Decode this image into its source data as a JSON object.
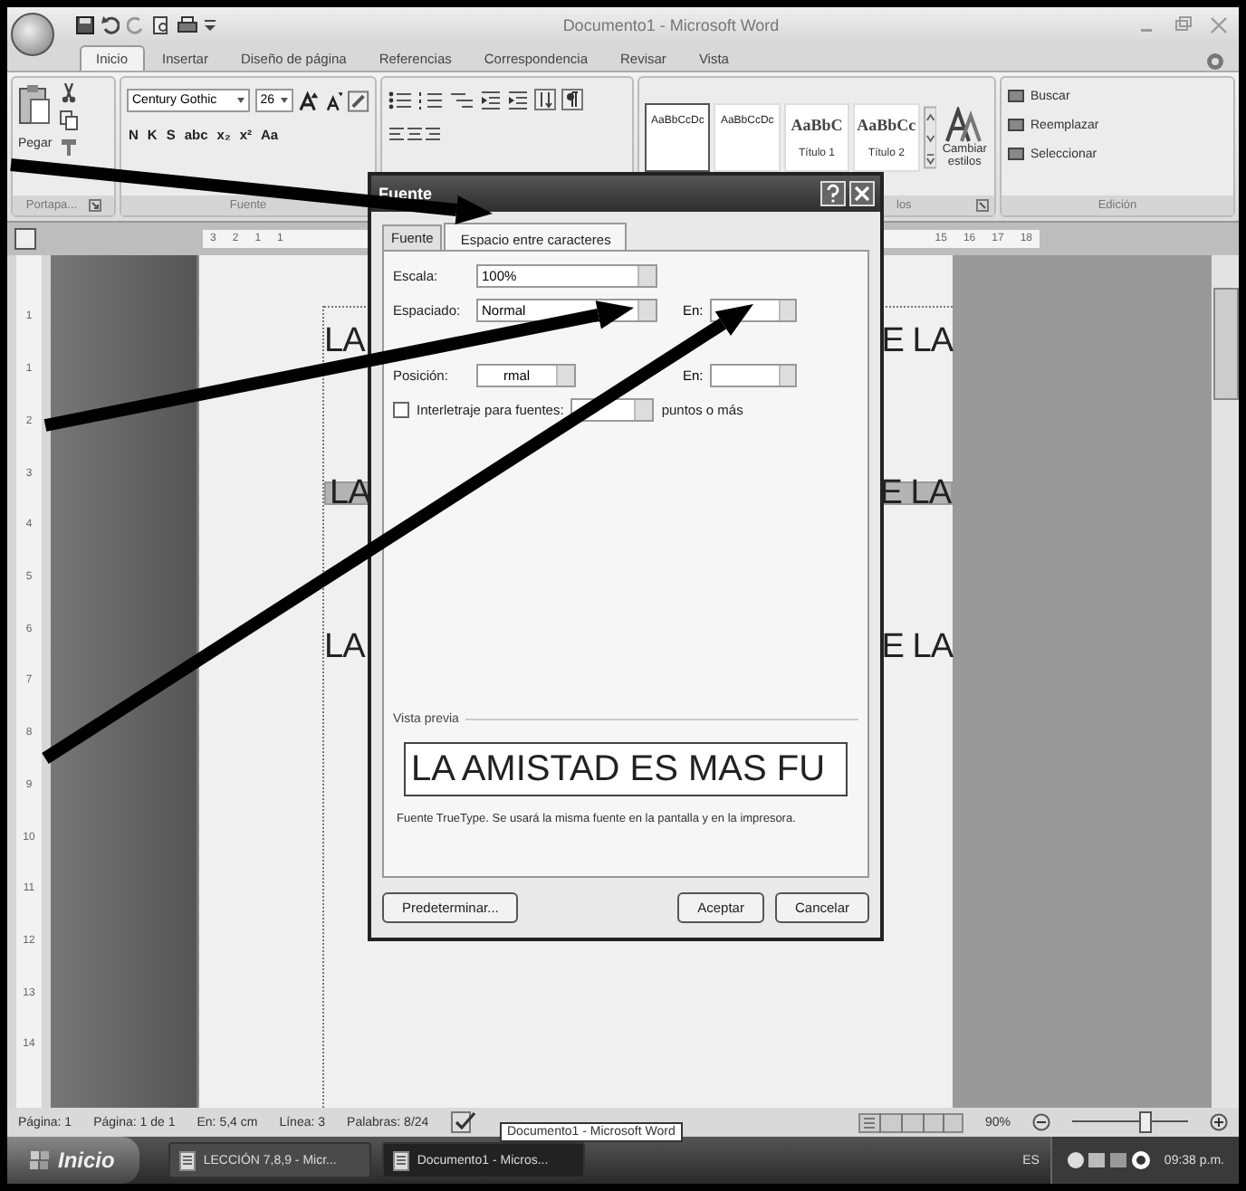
{
  "window": {
    "title": "Documento1 - Microsoft Word"
  },
  "tabs": [
    {
      "label": "Inicio",
      "selected": true
    },
    {
      "label": "Insertar",
      "selected": false
    },
    {
      "label": "Diseño de página",
      "selected": false
    },
    {
      "label": "Referencias",
      "selected": false
    },
    {
      "label": "Correspondencia",
      "selected": false
    },
    {
      "label": "Revisar",
      "selected": false
    },
    {
      "label": "Vista",
      "selected": false
    }
  ],
  "ribbon": {
    "clipboard": {
      "paste_label": "Pegar",
      "group_label": "Portapa..."
    },
    "font": {
      "font_name": "Century Gothic",
      "font_size": "26",
      "format_buttons": [
        "N",
        "K",
        "S",
        "abc",
        "x₂",
        "x²",
        "Aa"
      ],
      "group_label": "Fuente"
    },
    "styles": {
      "items": [
        {
          "sample": "AaBbCcDc",
          "kind": "body",
          "selected": true
        },
        {
          "sample": "AaBbCcDc",
          "kind": "body",
          "selected": false
        },
        {
          "sample": "AaBbC",
          "label": "Título 1",
          "kind": "heading",
          "selected": false
        },
        {
          "sample": "AaBbCc",
          "label": "Título 2",
          "kind": "heading",
          "selected": false
        }
      ],
      "change_styles": "Cambiar estilos",
      "group_label": "los"
    },
    "editing": {
      "items": [
        "Buscar",
        "Reemplazar",
        "Seleccionar"
      ],
      "group_label": "Edición"
    }
  },
  "ruler": {
    "left_numbers": [
      "3",
      "2",
      "1",
      "1"
    ],
    "right_numbers": [
      "15",
      "16",
      "17",
      "18"
    ]
  },
  "vertical_ruler": [
    "1",
    "1",
    "2",
    "3",
    "4",
    "5",
    "6",
    "7",
    "8",
    "9",
    "10",
    "11",
    "12",
    "13",
    "14"
  ],
  "document": {
    "lines": [
      {
        "left": "LA",
        "right": "E LA",
        "selected": false
      },
      {
        "left": "LA",
        "right": "E LA",
        "selected": true
      },
      {
        "left": "LA",
        "right": "E LA",
        "selected": false
      }
    ]
  },
  "dialog": {
    "title": "Fuente",
    "tabs": [
      {
        "label": "Fuente",
        "selected": false
      },
      {
        "label": "Espacio entre caracteres",
        "selected": true
      }
    ],
    "scale": {
      "label": "Escala:",
      "value": "100%"
    },
    "spacing": {
      "label": "Espaciado:",
      "value": "Normal",
      "by_label": "En:"
    },
    "position": {
      "label": "Posición:",
      "value": "rmal",
      "by_label": "En:"
    },
    "kerning": {
      "label": "Interletraje para fuentes:",
      "checked": false,
      "suffix": "puntos o más"
    },
    "preview": {
      "heading": "Vista previa",
      "sample": "LA AMISTAD ES MAS FU",
      "note": "Fuente TrueType. Se usará la misma fuente en la pantalla y en la impresora."
    },
    "buttons": [
      {
        "label": "Predeterminar...",
        "kind": "left"
      },
      {
        "label": "Aceptar",
        "kind": "right"
      },
      {
        "label": "Cancelar",
        "kind": "right"
      }
    ]
  },
  "status_bar": {
    "items": [
      "Página: 1",
      "Página: 1 de 1",
      "En: 5,4 cm",
      "Línea: 3",
      "Palabras: 8/24"
    ],
    "tooltip": "Documento1 - Microsoft Word",
    "zoom": "90%",
    "zoom_slider": {
      "level": 0.62
    }
  },
  "taskbar": {
    "start": "Inicio",
    "windows": [
      {
        "label": "LECCIÓN 7,8,9 - Micr...",
        "selected": false
      },
      {
        "label": "Documento1 - Micros...",
        "selected": true
      }
    ],
    "language": "ES",
    "clock": "09:38 p.m."
  }
}
